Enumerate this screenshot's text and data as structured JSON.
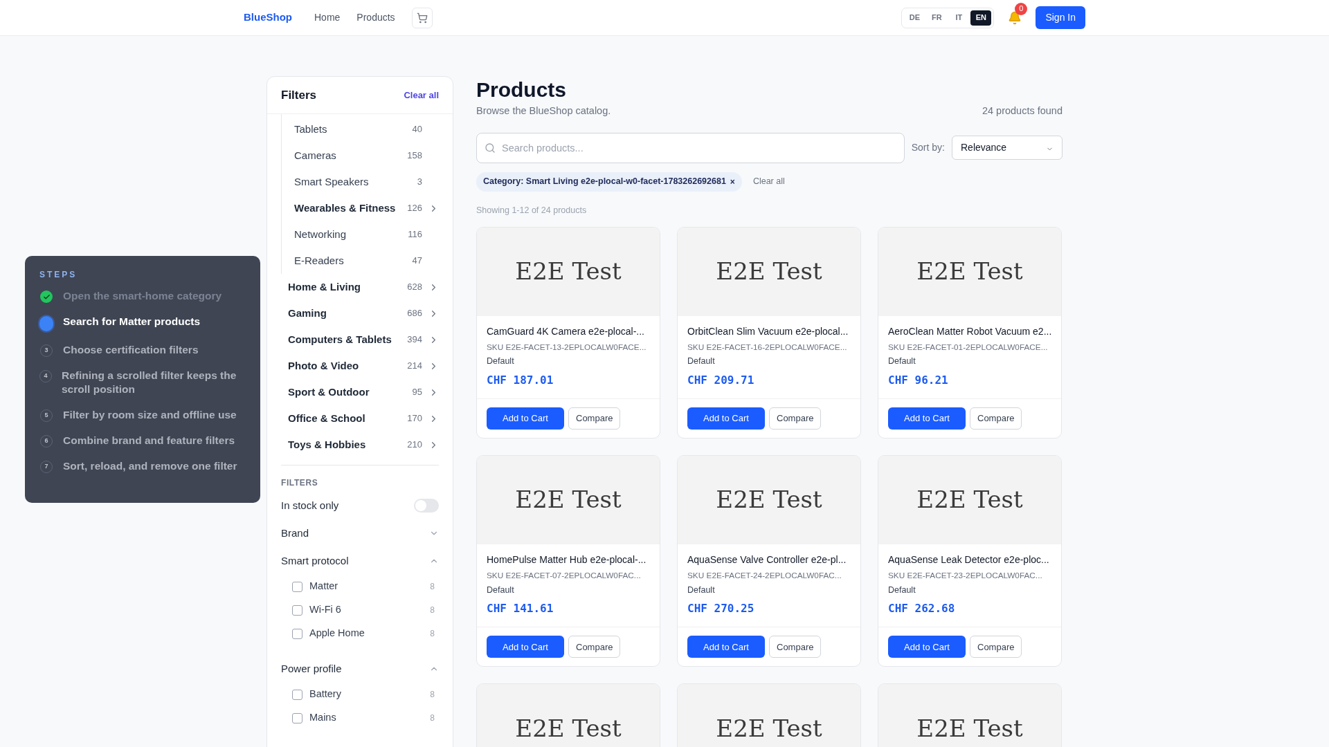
{
  "header": {
    "logo": "BlueShop",
    "nav": [
      "Home",
      "Products"
    ],
    "languages": [
      {
        "label": "DE",
        "selected": false
      },
      {
        "label": "FR",
        "selected": false
      },
      {
        "label": "IT",
        "selected": false
      },
      {
        "label": "EN",
        "selected": true
      }
    ],
    "notification_count": "0",
    "sign_in": "Sign In"
  },
  "steps": {
    "title": "STEPS",
    "items": [
      {
        "label": "Open the smart-home category",
        "completed": true,
        "current": false
      },
      {
        "label": "Search for Matter products",
        "completed": false,
        "current": true
      },
      {
        "label": "Choose certification filters",
        "completed": false,
        "current": false,
        "number": "3"
      },
      {
        "label": "Refining a scrolled filter keeps the scroll position",
        "completed": false,
        "current": false,
        "number": "4"
      },
      {
        "label": "Filter by room size and offline use",
        "completed": false,
        "current": false,
        "number": "5"
      },
      {
        "label": "Combine brand and feature filters",
        "completed": false,
        "current": false,
        "number": "6"
      },
      {
        "label": "Sort, reload, and remove one filter",
        "completed": false,
        "current": false,
        "number": "7"
      }
    ]
  },
  "sidebar": {
    "title": "Filters",
    "clear_all": "Clear all",
    "categories": [
      {
        "children": [
          {
            "label": "Tablets",
            "count": "40",
            "expandable": false
          },
          {
            "label": "Cameras",
            "count": "158",
            "expandable": false
          },
          {
            "label": "Smart Speakers",
            "count": "3",
            "expandable": false
          },
          {
            "label": "Wearables & Fitness",
            "count": "126",
            "expandable": true
          },
          {
            "label": "Networking",
            "count": "116",
            "expandable": false
          },
          {
            "label": "E-Readers",
            "count": "47",
            "expandable": false
          }
        ]
      },
      {
        "label": "Home & Living",
        "count": "628",
        "expandable": true
      },
      {
        "label": "Gaming",
        "count": "686",
        "expandable": true
      },
      {
        "label": "Computers & Tablets",
        "count": "394",
        "expandable": true
      },
      {
        "label": "Photo & Video",
        "count": "214",
        "expandable": true
      },
      {
        "label": "Sport & Outdoor",
        "count": "95",
        "expandable": true
      },
      {
        "label": "Office & School",
        "count": "170",
        "expandable": true
      },
      {
        "label": "Toys & Hobbies",
        "count": "210",
        "expandable": true
      }
    ],
    "filters_heading": "FILTERS",
    "in_stock": {
      "label": "In stock only",
      "on": false
    },
    "groups": [
      {
        "label": "Brand",
        "expanded": false
      },
      {
        "label": "Smart protocol",
        "expanded": true,
        "options": [
          {
            "label": "Matter",
            "count": "8",
            "checked": false
          },
          {
            "label": "Wi-Fi 6",
            "count": "8",
            "checked": false
          },
          {
            "label": "Apple Home",
            "count": "8",
            "checked": false
          }
        ]
      },
      {
        "label": "Power profile",
        "expanded": true,
        "options": [
          {
            "label": "Battery",
            "count": "8",
            "checked": false
          },
          {
            "label": "Mains",
            "count": "8",
            "checked": false
          }
        ]
      }
    ]
  },
  "main": {
    "title": "Products",
    "subtitle": "Browse the BlueShop catalog.",
    "found": "24 products found",
    "search": {
      "placeholder": "Search products..."
    },
    "sort_label": "Sort by:",
    "sort_value": "Relevance",
    "active_filters": [
      {
        "label": "Category: Smart Living e2e-plocal-w0-facet-1783262692681",
        "remove": "×"
      }
    ],
    "clear_all": "Clear all",
    "showing": "Showing 1-12 of 24 products",
    "products": [
      {
        "image_text": "E2E Test",
        "name": "CamGuard 4K Camera e2e-plocal-...",
        "sku": "SKU E2E-FACET-13-2EPLOCALW0FACE...",
        "variant": "Default",
        "price": "CHF 187.01",
        "add": "Add to Cart",
        "compare": "Compare"
      },
      {
        "image_text": "E2E Test",
        "name": "OrbitClean Slim Vacuum e2e-plocal...",
        "sku": "SKU E2E-FACET-16-2EPLOCALW0FACE...",
        "variant": "Default",
        "price": "CHF 209.71",
        "add": "Add to Cart",
        "compare": "Compare"
      },
      {
        "image_text": "E2E Test",
        "name": "AeroClean Matter Robot Vacuum e2...",
        "sku": "SKU E2E-FACET-01-2EPLOCALW0FACE...",
        "variant": "Default",
        "price": "CHF 96.21",
        "add": "Add to Cart",
        "compare": "Compare"
      },
      {
        "image_text": "E2E Test",
        "name": "HomePulse Matter Hub e2e-plocal-...",
        "sku": "SKU E2E-FACET-07-2EPLOCALW0FAC...",
        "variant": "Default",
        "price": "CHF 141.61",
        "add": "Add to Cart",
        "compare": "Compare"
      },
      {
        "image_text": "E2E Test",
        "name": "AquaSense Valve Controller e2e-pl...",
        "sku": "SKU E2E-FACET-24-2EPLOCALW0FAC...",
        "variant": "Default",
        "price": "CHF 270.25",
        "add": "Add to Cart",
        "compare": "Compare"
      },
      {
        "image_text": "E2E Test",
        "name": "AquaSense Leak Detector e2e-ploc...",
        "sku": "SKU E2E-FACET-23-2EPLOCALW0FAC...",
        "variant": "Default",
        "price": "CHF 262.68",
        "add": "Add to Cart",
        "compare": "Compare"
      },
      {
        "image_text": "E2E Test"
      },
      {
        "image_text": "E2E Test"
      },
      {
        "image_text": "E2E Test"
      }
    ]
  }
}
